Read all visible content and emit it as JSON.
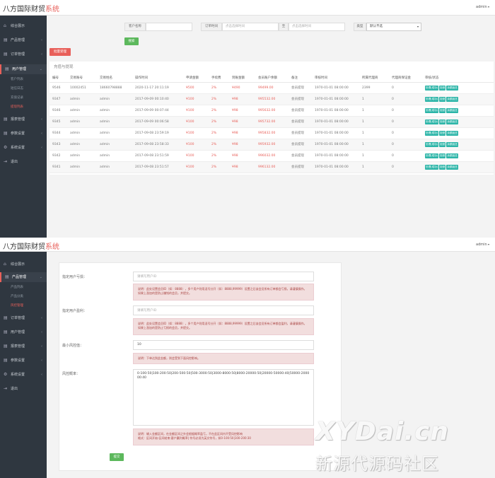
{
  "brand": {
    "name": "八方国际财贸",
    "suffix": "系统"
  },
  "screen1": {
    "user": "admin",
    "sidebar": [
      {
        "icon": "⌂",
        "label": "综合展示",
        "arrow": ""
      },
      {
        "icon": "▤",
        "label": "产品管理",
        "arrow": "‹"
      },
      {
        "icon": "▤",
        "label": "订单管理",
        "arrow": "‹"
      },
      {
        "icon": "▤",
        "label": "用户管理",
        "arrow": "⌄"
      },
      {
        "icon": "▤",
        "label": "报表管理",
        "arrow": "‹"
      },
      {
        "icon": "▤",
        "label": "参数设置",
        "arrow": "‹"
      },
      {
        "icon": "⚙",
        "label": "系统设置",
        "arrow": "‹"
      },
      {
        "icon": "⇥",
        "label": "退出",
        "arrow": ""
      }
    ],
    "subitems": [
      "客户列表",
      "短信日志",
      "充值记录",
      "提现列表"
    ],
    "filter": {
      "customer_label": "客户名称",
      "time_label": "订单时间",
      "start_placeholder": "点击选择时间",
      "to": "至",
      "end_placeholder": "点击选择时间",
      "type_label": "类型",
      "type_value": "默认不选",
      "search": "搜索",
      "batch": "批量受理"
    },
    "panel_title": "充值与提现",
    "columns": [
      "编号",
      "交易账号",
      "交易姓名",
      "操作时间",
      "申请金额",
      "手续费",
      "到账金额",
      "会员账户余额",
      "备注",
      "审核时间",
      "所属代理商",
      "代理商保证金",
      "审核/状态"
    ],
    "rows": [
      [
        "9546",
        "10002451",
        "18660798888",
        "2020-11-17 20:11:19",
        "¥500",
        "2%",
        "¥490",
        "99499.00",
        "会员提现",
        "1970-01-01 08:00:00",
        "2399",
        "0"
      ],
      [
        "9347",
        "admin",
        "admin",
        "2017-09-09 00:10:40",
        "¥100",
        "2%",
        "¥98",
        "995532.00",
        "会员提现",
        "1970-01-01 08:00:00",
        "1",
        "0"
      ],
      [
        "9346",
        "admin",
        "admin",
        "2017-09-09 00:07:44",
        "¥100",
        "2%",
        "¥98",
        "995632.00",
        "会员提现",
        "1970-01-01 08:00:00",
        "1",
        "0"
      ],
      [
        "9345",
        "admin",
        "admin",
        "2017-09-09 00:06:58",
        "¥100",
        "2%",
        "¥98",
        "995732.00",
        "会员提现",
        "1970-01-01 08:00:00",
        "1",
        "0"
      ],
      [
        "9344",
        "admin",
        "admin",
        "2017-09-08 23:59:19",
        "¥100",
        "2%",
        "¥98",
        "995832.00",
        "会员提现",
        "1970-01-01 08:00:00",
        "1",
        "0"
      ],
      [
        "9343",
        "admin",
        "admin",
        "2017-09-08 23:58:33",
        "¥100",
        "2%",
        "¥98",
        "995932.00",
        "会员提现",
        "1970-01-01 08:00:00",
        "1",
        "0"
      ],
      [
        "9342",
        "admin",
        "admin",
        "2017-09-08 23:51:59",
        "¥100",
        "2%",
        "¥98",
        "996032.00",
        "会员提现",
        "1970-01-01 08:00:00",
        "1",
        "0"
      ],
      [
        "9341",
        "admin",
        "admin",
        "2017-09-08 23:51:57",
        "¥100",
        "2%",
        "¥98",
        "996132.00",
        "会员提现",
        "1970-01-01 08:00:00",
        "1",
        "0"
      ]
    ],
    "actions": [
      "处理(成功)",
      "拒绝",
      "余额返还"
    ]
  },
  "screen2": {
    "user": "admin",
    "sidebar": [
      {
        "icon": "⌂",
        "label": "综合展示",
        "arrow": ""
      },
      {
        "icon": "▤",
        "label": "产品管理",
        "arrow": "⌄"
      },
      {
        "icon": "▤",
        "label": "订单管理",
        "arrow": "‹"
      },
      {
        "icon": "▤",
        "label": "用户管理",
        "arrow": "‹"
      },
      {
        "icon": "▤",
        "label": "报表管理",
        "arrow": "‹"
      },
      {
        "icon": "▤",
        "label": "参数设置",
        "arrow": "‹"
      },
      {
        "icon": "⚙",
        "label": "系统设置",
        "arrow": "‹"
      },
      {
        "icon": "⇥",
        "label": "退出",
        "arrow": ""
      }
    ],
    "subitems": [
      "产品列表",
      "产品分类",
      "风控管理"
    ],
    "form": {
      "f1_label": "指定用户亏损：",
      "f1_placeholder": "请填写用户ID",
      "f1_alert": "说明：此处设置会员ID（如：8888），多个用户则用逗号分开（如：8888,99999）设置之后该会员所有订单都会亏损，请谨慎操作。如果上涨加的是防止赚钱的会员，并提交。",
      "f2_label": "指定用户盈利：",
      "f2_placeholder": "请填写用户ID",
      "f2_alert": "说明：此处设置会员ID（如：8888），多个用户则用逗号分开（如：8888,99999）设置之后该会员所有订单都会盈利，请谨慎操作。如果上涨加的是防止亏损的会员，并提交。",
      "f3_label": "最小风控值：",
      "f3_value": "10",
      "f3_alert": "说明：下单达到此金额，则会受到下面风控影响。",
      "f4_label": "风控概率：",
      "f4_value": "0-100:50|100-200:50|200-500:50|500-3000:50|3000-8000:50|8000-20000:50|20000-50000:40|50000-200000:40",
      "f4_alert_1": "说明：输入金额区间，在金额区间之外会根据概率盈亏，不在此区间内不受风控影响",
      "f4_alert_2": "格式：区间开始-区间结束:客户赢利概率|      符号必须为英文符号，如0-100:50|100-200:30",
      "submit": "提交"
    }
  },
  "watermark": {
    "line1": "XYDai.cn",
    "line2": "新源代源码社区"
  }
}
